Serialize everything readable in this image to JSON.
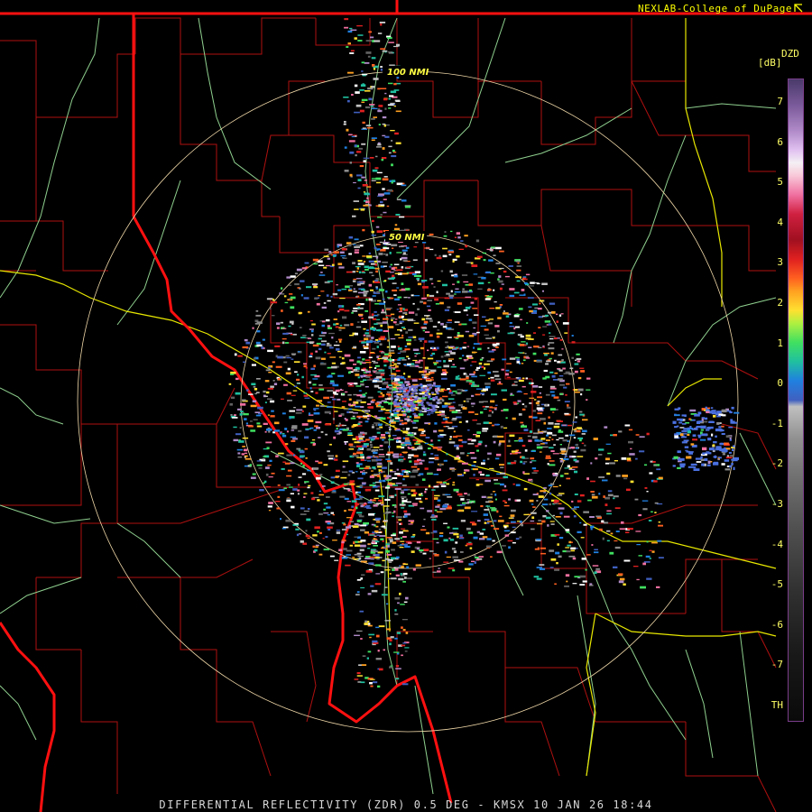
{
  "header": {
    "credit": "NEXLAB-College of DuPage"
  },
  "footer": {
    "caption": "DIFFERENTIAL REFLECTIVITY (ZDR) 0.5 DEG - KMSX 10 JAN 26 18:44"
  },
  "legend": {
    "product": "DZD",
    "unit": "[dB]",
    "ticks": [
      "7",
      "6",
      "5",
      "4",
      "3",
      "2",
      "1",
      "0",
      "-1",
      "-2",
      "-3",
      "-4",
      "-5",
      "-6",
      "-7",
      "TH"
    ]
  },
  "map": {
    "range_rings": [
      "100 NMI",
      "50 NMI"
    ],
    "colors": {
      "background": "#000000",
      "state_border": "#ff1010",
      "county_lines": "#b01010",
      "rivers": "#8fd08f",
      "highways": "#e8e800",
      "range_rings": "#f0d8a8",
      "ring_label": "#ffff44"
    }
  }
}
